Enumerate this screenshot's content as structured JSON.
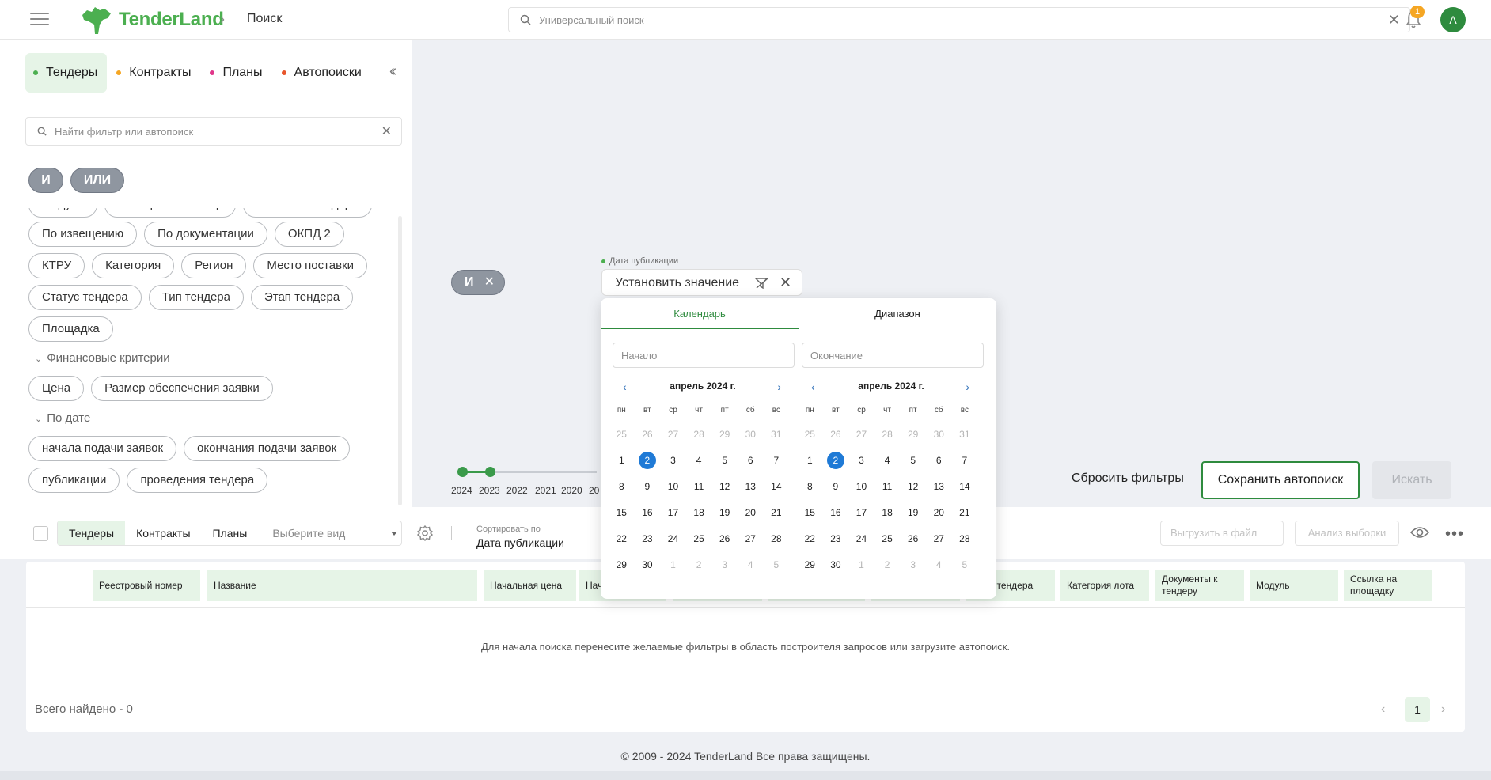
{
  "header": {
    "logo_text": "TenderLand",
    "breadcrumb": "Поиск",
    "search_placeholder": "Универсальный поиск",
    "notification_count": "1",
    "avatar_letter": "А"
  },
  "left_panel": {
    "tabs": [
      {
        "label": "Тендеры",
        "color": "#4caf50"
      },
      {
        "label": "Контракты",
        "color": "#f5a623"
      },
      {
        "label": "Планы",
        "color": "#e0368a"
      },
      {
        "label": "Автопоиски",
        "color": "#e8552b"
      }
    ],
    "filter_search_placeholder": "Найти фильтр или автопоиск",
    "logic_and": "И",
    "logic_or": "ИЛИ",
    "chip_rows": [
      [
        "Модуль",
        "Реестровый номер",
        "Название тендера"
      ],
      [
        "По извещению",
        "По документации",
        "ОКПД 2"
      ],
      [
        "КТРУ",
        "Категория",
        "Регион",
        "Место поставки"
      ],
      [
        "Статус тендера",
        "Тип тендера",
        "Этап тендера"
      ],
      [
        "Площадка"
      ]
    ],
    "group_finance": "Финансовые критерии",
    "finance_chips": [
      "Цена",
      "Размер обеспечения заявки"
    ],
    "group_date": "По дате",
    "date_chips_row1": [
      "начала подачи заявок",
      "окончания подачи заявок"
    ],
    "date_chips_row2": [
      "публикации",
      "проведения тендера"
    ]
  },
  "builder": {
    "and_label": "И",
    "field_label": "Дата публикации",
    "value_label": "Установить значение",
    "timeline_years": [
      "2024",
      "2023",
      "2022",
      "2021",
      "2020",
      "20"
    ],
    "reset_label": "Сбросить фильтры",
    "save_label": "Сохранить автопоиск",
    "search_label": "Искать"
  },
  "calendar": {
    "tab_calendar": "Календарь",
    "tab_range": "Диапазон",
    "start_placeholder": "Начало",
    "end_placeholder": "Окончание",
    "month_title": "апрель 2024 г.",
    "weekdays": [
      "пн",
      "вт",
      "ср",
      "чт",
      "пт",
      "сб",
      "вс"
    ],
    "weeks": [
      [
        "25",
        "26",
        "27",
        "28",
        "29",
        "30",
        "31"
      ],
      [
        "1",
        "2",
        "3",
        "4",
        "5",
        "6",
        "7"
      ],
      [
        "8",
        "9",
        "10",
        "11",
        "12",
        "13",
        "14"
      ],
      [
        "15",
        "16",
        "17",
        "18",
        "19",
        "20",
        "21"
      ],
      [
        "22",
        "23",
        "24",
        "25",
        "26",
        "27",
        "28"
      ],
      [
        "29",
        "30",
        "1",
        "2",
        "3",
        "4",
        "5"
      ]
    ],
    "selected_day": "2"
  },
  "results": {
    "tabs": [
      "Тендеры",
      "Контракты",
      "Планы"
    ],
    "view_placeholder": "Выберите вид",
    "sort_label": "Сортировать по",
    "sort_value": "Дата публикации",
    "export_label": "Выгрузить в файл",
    "analysis_label": "Анализ выборки",
    "columns": [
      "Реестровый номер",
      "Название",
      "Начальная цена",
      "Начало закупки",
      "",
      "",
      "",
      "Этап тендера",
      "Категория лота",
      "Документы к тендеру",
      "Модуль",
      "Ссылка на площадку"
    ],
    "empty_message": "Для начала поиска перенесите желаемые фильтры в область построителя запросов или загрузите автопоиск.",
    "total_found": "Всего найдено - 0",
    "current_page": "1"
  },
  "footer": {
    "copyright": "© 2009 - 2024 TenderLand Все права защищены."
  }
}
